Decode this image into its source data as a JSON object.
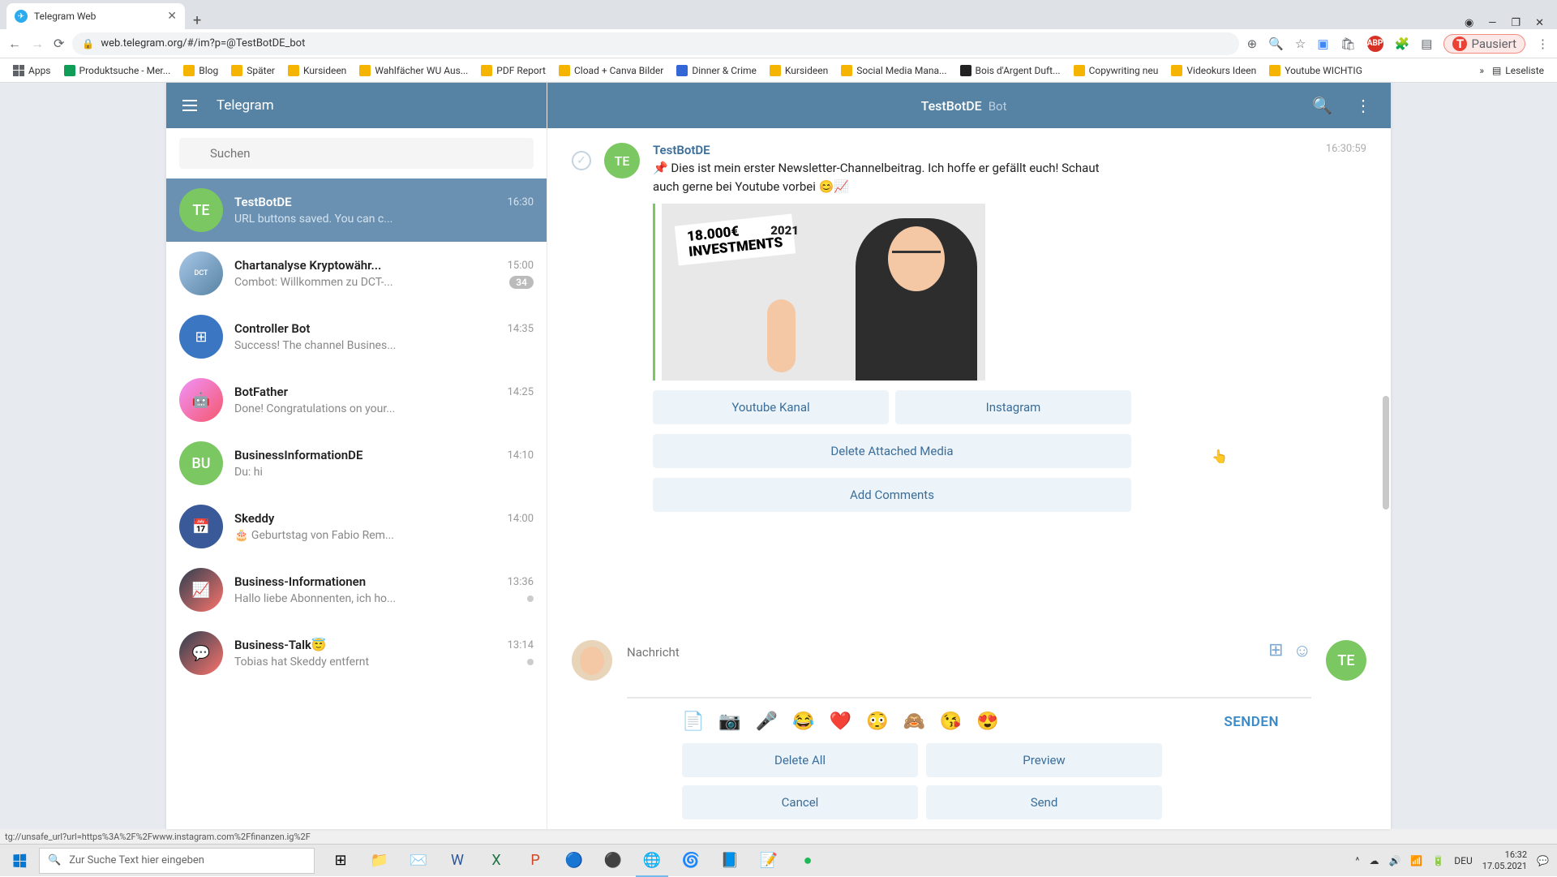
{
  "browser": {
    "tab_title": "Telegram Web",
    "url": "web.telegram.org/#/im?p=@TestBotDE_bot",
    "profile_label": "Pausiert",
    "bookmarks": [
      "Apps",
      "Produktsuche - Mer...",
      "Blog",
      "Später",
      "Kursideen",
      "Wahlfächer WU Aus...",
      "PDF Report",
      "Cload + Canva Bilder",
      "Dinner & Crime",
      "Kursideen",
      "Social Media Mana...",
      "Bois d'Argent Duft...",
      "Copywriting neu",
      "Videokurs Ideen",
      "Youtube WICHTIG"
    ],
    "bookmarks_right": "Leseliste"
  },
  "telegram": {
    "app_title": "Telegram",
    "search_placeholder": "Suchen",
    "header": {
      "name": "TestBotDE",
      "type": "Bot"
    },
    "chats": [
      {
        "initials": "TE",
        "name": "TestBotDE",
        "time": "16:30",
        "preview": "URL buttons saved. You can c..."
      },
      {
        "initials": "",
        "name": "Chartanalyse Kryptowähr...",
        "time": "15:00",
        "preview": "Combot: Willkommen zu DCT-...",
        "badge": "34"
      },
      {
        "initials": "",
        "name": "Controller Bot",
        "time": "14:35",
        "preview": "Success! The channel Busines..."
      },
      {
        "initials": "",
        "name": "BotFather",
        "time": "14:25",
        "preview": "Done! Congratulations on your..."
      },
      {
        "initials": "BU",
        "name": "BusinessInformationDE",
        "time": "14:10",
        "preview": "Du: hi"
      },
      {
        "initials": "",
        "name": "Skeddy",
        "time": "14:00",
        "preview": "🎂 Geburtstag von Fabio Rem..."
      },
      {
        "initials": "",
        "name": "Business-Informationen",
        "time": "13:36",
        "preview": "Hallo liebe Abonnenten, ich ho...",
        "dot": true
      },
      {
        "initials": "",
        "name": "Business-Talk😇",
        "time": "13:14",
        "preview": "Tobias hat Skeddy entfernt",
        "dot": true
      }
    ],
    "message": {
      "sender": "TestBotDE",
      "time": "16:30:59",
      "avatar": "TE",
      "text": "📌 Dies ist mein erster Newsletter-Channelbeitrag. Ich hoffe er gefällt euch! Schaut auch gerne bei Youtube vorbei 😊📈",
      "thumb_text_line1": "18.000€",
      "thumb_text_line2": "INVESTMENTS",
      "thumb_year": "2021",
      "buttons_row1": [
        "Youtube Kanal",
        "Instagram"
      ],
      "buttons_row2": "Delete Attached Media",
      "buttons_row3": "Add Comments"
    },
    "composer": {
      "placeholder": "Nachricht",
      "send_label": "SENDEN",
      "send_avatar": "TE",
      "emoji": [
        "😂",
        "❤️",
        "😳",
        "🙈",
        "😘",
        "😍"
      ],
      "bottom_buttons": [
        "Delete All",
        "Preview",
        "Cancel",
        "Send"
      ]
    }
  },
  "status_link": "tg://unsafe_url?url=https%3A%2F%2Fwww.instagram.com%2Ffinanzen.ig%2F",
  "taskbar": {
    "search_placeholder": "Zur Suche Text hier eingeben",
    "lang": "DEU",
    "time": "16:32",
    "date": "17.05.2021"
  }
}
